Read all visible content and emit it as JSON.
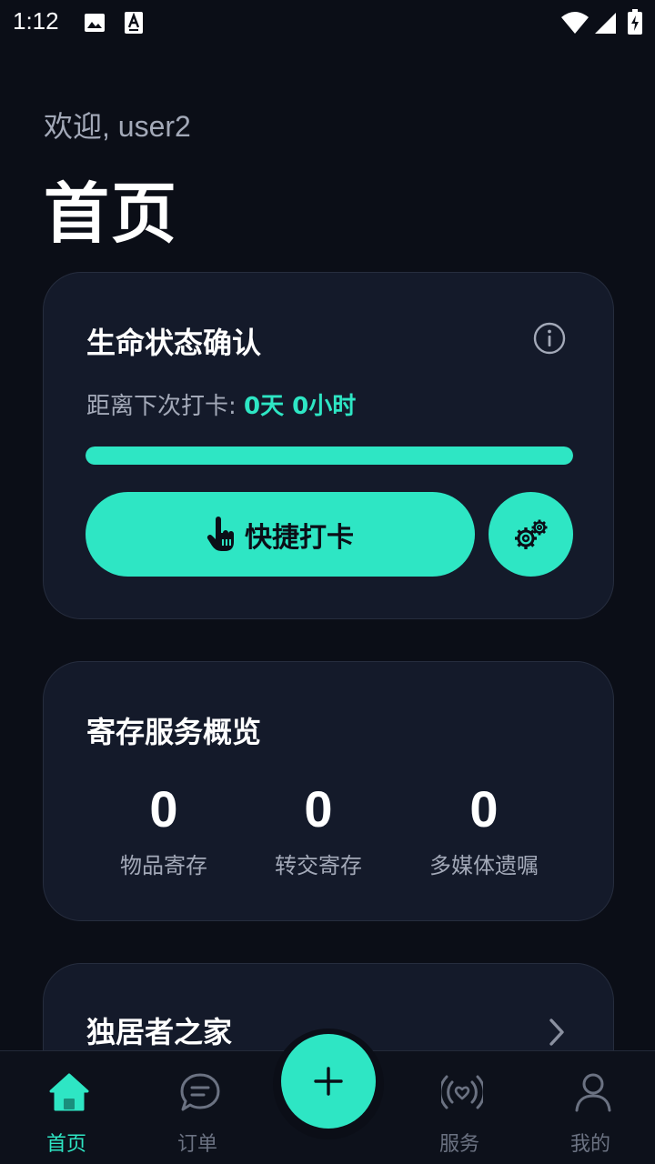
{
  "status_bar": {
    "time": "1:12"
  },
  "header": {
    "welcome": "欢迎, user2",
    "title": "首页"
  },
  "life_status": {
    "title": "生命状态确认",
    "countdown_label": "距离下次打卡: ",
    "countdown_value": "0天 0小时",
    "progress_fraction": 1.0,
    "checkin_label": "快捷打卡"
  },
  "storage": {
    "title": "寄存服务概览",
    "stats": [
      {
        "value": "0",
        "label": "物品寄存"
      },
      {
        "value": "0",
        "label": "转交寄存"
      },
      {
        "value": "0",
        "label": "多媒体遗嘱"
      }
    ]
  },
  "home_card": {
    "title": "独居者之家"
  },
  "nav": {
    "items": [
      {
        "label": "首页",
        "icon": "home-icon",
        "active": true
      },
      {
        "label": "订单",
        "icon": "chat-icon",
        "active": false
      },
      {
        "label": "服务",
        "icon": "broadcast-heart-icon",
        "active": false
      },
      {
        "label": "我的",
        "icon": "user-icon",
        "active": false
      }
    ],
    "fab_icon": "plus-icon"
  },
  "colors": {
    "accent": "#2ee6c4",
    "background": "#0b0e17",
    "card": "#141a2a",
    "muted_text": "#a3a9b8",
    "nav_inactive": "#6b7282"
  }
}
